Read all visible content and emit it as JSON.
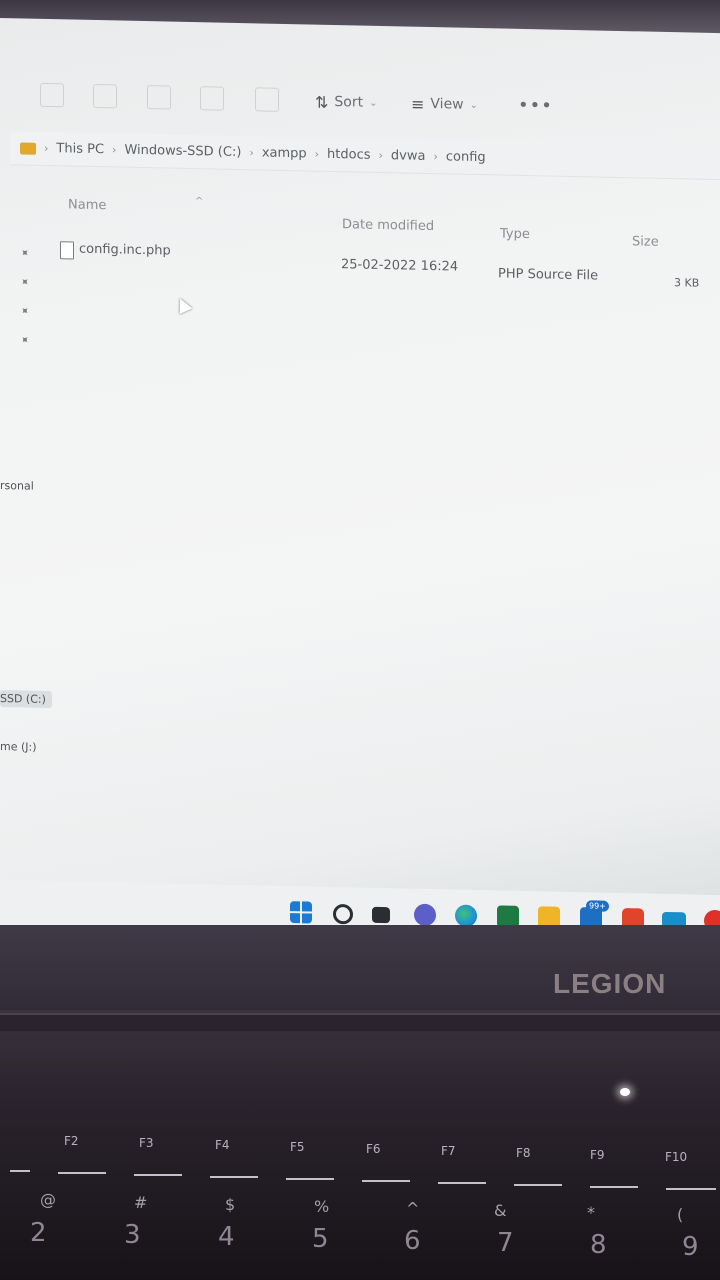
{
  "toolbar": {
    "sort_label": "Sort",
    "view_label": "View",
    "more_label": "•••"
  },
  "breadcrumb": [
    "This PC",
    "Windows-SSD (C:)",
    "xampp",
    "htdocs",
    "dvwa",
    "config"
  ],
  "columns": {
    "name": "Name",
    "date_modified": "Date modified",
    "type": "Type",
    "size": "Size"
  },
  "files": [
    {
      "name": "config.inc.php",
      "date_modified": "25-02-2022 16:24",
      "type": "PHP Source File",
      "size": "3 KB"
    }
  ],
  "nav_pane": {
    "item_personal": "rsonal",
    "item_ssd": "SSD (C:)",
    "item_me": "me (J:)"
  },
  "taskbar": {
    "outlook_badge": "99+"
  },
  "laptop": {
    "logo": "LEGION",
    "fkeys": [
      "F2",
      "F3",
      "F4",
      "F5",
      "F6",
      "F7",
      "F8",
      "F9",
      "F10"
    ],
    "number_keys": [
      "2",
      "3",
      "4",
      "5",
      "6",
      "7",
      "8",
      "9"
    ],
    "symbol_keys": [
      "@",
      "#",
      "$",
      "%",
      "^",
      "&",
      "*",
      "("
    ]
  }
}
